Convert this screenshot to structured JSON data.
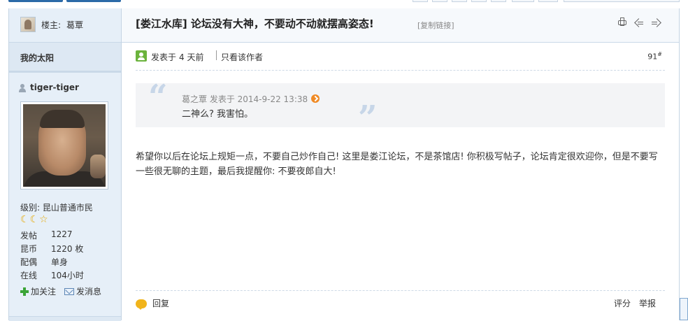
{
  "sidebar": {
    "host_label": "楼主:",
    "host_name": "葛覃",
    "sun_title": "我的太阳",
    "username": "tiger-tiger",
    "level_text": "级别: 昆山普通市民",
    "stats": [
      {
        "label": "发帖",
        "value": "1227"
      },
      {
        "label": "昆币",
        "value": "1220 枚"
      },
      {
        "label": "配偶",
        "value": "单身"
      },
      {
        "label": "在线",
        "value": "104小时"
      }
    ],
    "follow_label": "加关注",
    "message_label": "发消息"
  },
  "post": {
    "title": "[娄江水库] 论坛没有大神，不要动不动就摆高姿态!",
    "copy_link": "[复制链接]",
    "posted_label": "发表于",
    "posted_time": "4 天前",
    "author_only": "只看该作者",
    "floor": "91",
    "floor_sup": "#",
    "quote": {
      "header": "葛之覃 发表于 2014-9-22 13:38",
      "text": "二神么? 我害怕。"
    },
    "body": "希望你以后在论坛上规矩一点，不要自己炒作自己! 这里是娄江论坛，不是茶馆店! 你积极写帖子，论坛肯定很欢迎你，但是不要写一些很无聊的主题，最后我提醒你: 不要夜郎自大!",
    "reply_label": "回复",
    "rate_label": "评分",
    "report_label": "举报"
  },
  "icons": [
    "print-icon",
    "prev-icon",
    "next-icon",
    "user-icon",
    "plus-icon",
    "mail-icon",
    "reply-icon",
    "arrow-icon"
  ],
  "colors": {
    "accent": "#2b6aa8",
    "sidebar_bg": "#e6eff8",
    "quote_bg": "#f3f4f6"
  }
}
